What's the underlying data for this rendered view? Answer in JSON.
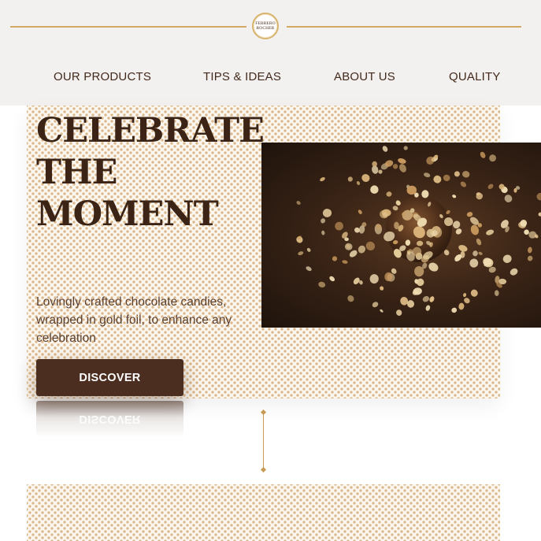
{
  "header": {
    "logo_line1": "FERRERO",
    "logo_line2": "ROCHER",
    "nav": [
      {
        "label": "OUR PRODUCTS"
      },
      {
        "label": "TIPS & IDEAS"
      },
      {
        "label": "ABOUT US"
      },
      {
        "label": "QUALITY"
      }
    ]
  },
  "hero": {
    "headline": [
      "CELEBRATE",
      "THE",
      "MOMENT"
    ],
    "description": "Lovingly crafted chocolate candies, wrapped in gold foil, to enhance any celebration",
    "button_label": "DISCOVER",
    "button_reflection": "DISCOVER",
    "image": "hazelnut-chocolate-burst"
  },
  "colors": {
    "gold": "#d1a962",
    "brown": "#4b2e20",
    "header_bg": "#f2f1ef"
  }
}
